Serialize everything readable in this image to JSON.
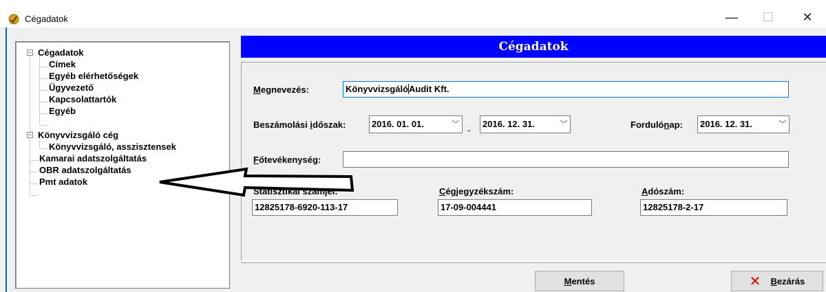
{
  "window": {
    "title": "Cégadatok",
    "minimize_glyph": "—",
    "maximize_glyph": "☐",
    "close_glyph": "✕"
  },
  "tree": {
    "items": [
      {
        "label": "Cégadatok",
        "level": 0,
        "expander": "−"
      },
      {
        "label": "Címek",
        "level": 1
      },
      {
        "label": "Egyéb elérhetőségek",
        "level": 1
      },
      {
        "label": "Ügyvezető",
        "level": 1
      },
      {
        "label": "Kapcsolattartók",
        "level": 1
      },
      {
        "label": "Egyéb",
        "level": 1
      },
      {
        "label": "Könyvvizsgáló cég",
        "level": 0,
        "expander": "−"
      },
      {
        "label": "Könyvvizsgáló, asszisztensek",
        "level": 1
      },
      {
        "label": "Kamarai adatszolgáltatás",
        "level": 0
      },
      {
        "label": "OBR adatszolgáltatás",
        "level": 0
      },
      {
        "label": "Pmt adatok",
        "level": 0
      }
    ]
  },
  "header": {
    "title": "Cégadatok"
  },
  "form": {
    "megnevezes": {
      "label_u": "M",
      "label_rest": "egnevezés:",
      "value_a": "Könyvvizsgáló",
      "value_b": "Audit Kft."
    },
    "beszamolasi": {
      "label_a": "Beszámolási ",
      "label_u": "i",
      "label_b": "dőszak:",
      "from": "2016. 01. 01.",
      "to": "2016. 12. 31.",
      "dash": "-"
    },
    "fordulonap": {
      "label_a": "Forduló",
      "label_u": "n",
      "label_b": "ap:",
      "value": "2016. 12. 31."
    },
    "fotevekenyseg": {
      "label_u": "F",
      "label_rest": "őtevékenység:",
      "value": ""
    },
    "statisztikai": {
      "label": "Statisztikai számjel:",
      "value": "12825178-6920-113-17"
    },
    "cegjegyzek": {
      "label_u": "C",
      "label_rest": "égjegyzékszám:",
      "value": "17-09-004441"
    },
    "adoszam": {
      "label_u": "A",
      "label_rest": "dószám:",
      "value": "12825178-2-17"
    },
    "chevron": "﹀"
  },
  "buttons": {
    "save": {
      "label_u": "M",
      "label_rest": "entés"
    },
    "close": {
      "icon": "✕",
      "label_u": "B",
      "label_rest": "ezárás"
    }
  },
  "colors": {
    "header_bg": "#0000ff",
    "close_icon": "#e00000",
    "accent": "#0078d7"
  }
}
